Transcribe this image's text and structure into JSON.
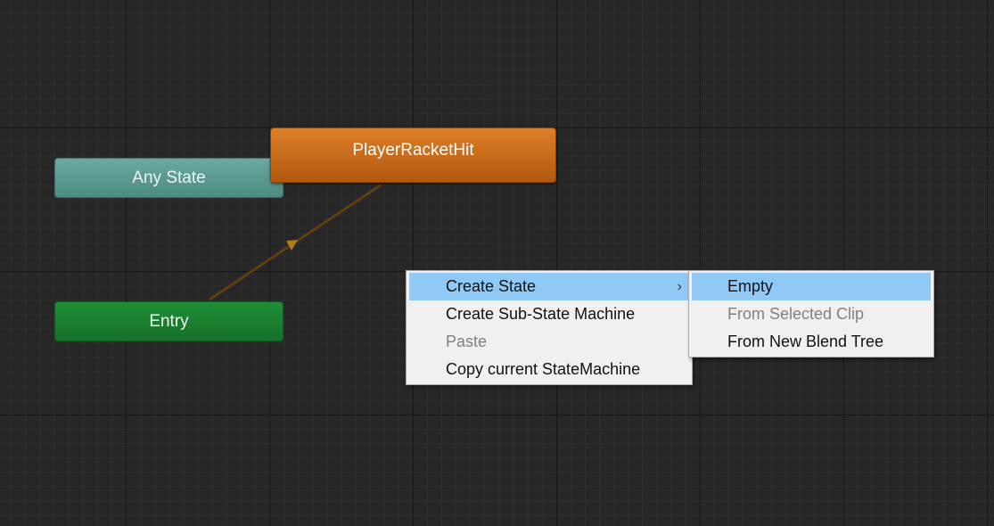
{
  "graph": {
    "nodes": {
      "any_state": "Any State",
      "entry": "Entry",
      "player_racket_hit": "PlayerRacketHit"
    }
  },
  "context_menu": {
    "items": [
      {
        "label": "Create State",
        "highlighted": true,
        "disabled": false,
        "has_submenu": true
      },
      {
        "label": "Create Sub-State Machine",
        "highlighted": false,
        "disabled": false
      },
      {
        "label": "Paste",
        "highlighted": false,
        "disabled": true
      },
      {
        "label": "Copy current StateMachine",
        "highlighted": false,
        "disabled": false
      }
    ],
    "submenu_arrow": "›"
  },
  "submenu": {
    "items": [
      {
        "label": "Empty",
        "highlighted": true,
        "disabled": false
      },
      {
        "label": "From Selected Clip",
        "highlighted": false,
        "disabled": true
      },
      {
        "label": "From New Blend Tree",
        "highlighted": false,
        "disabled": false
      }
    ]
  },
  "colors": {
    "canvas_bg": "#272727",
    "any_state": "#5b9b90",
    "entry": "#188032",
    "default_state": "#c96b1c",
    "transition": "#5a4014",
    "transition_arrow": "#b37d14",
    "menu_highlight": "#90c8f6"
  }
}
